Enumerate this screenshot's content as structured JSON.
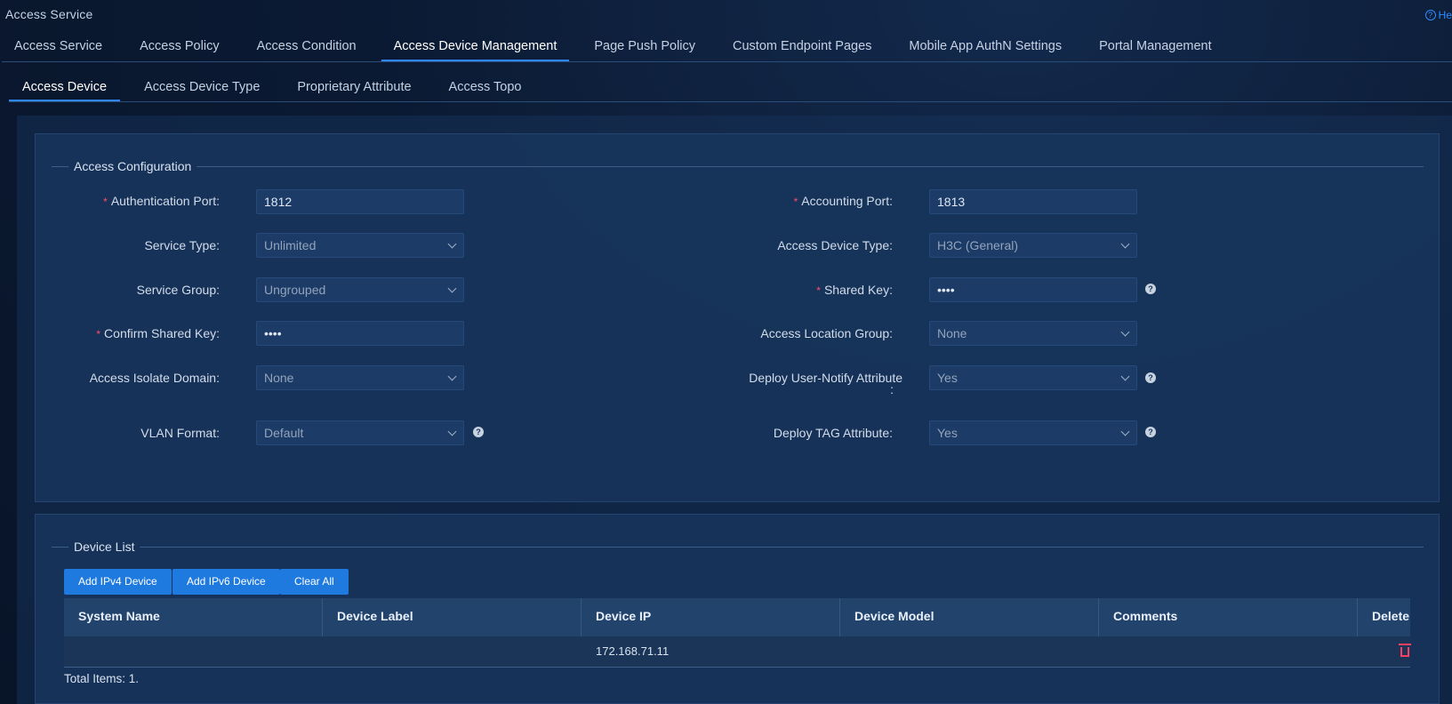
{
  "app": {
    "title": "Access Service",
    "help_label": "He"
  },
  "main_tabs": [
    {
      "label": "Access Service"
    },
    {
      "label": "Access Policy"
    },
    {
      "label": "Access Condition"
    },
    {
      "label": "Access Device Management",
      "active": true
    },
    {
      "label": "Page Push Policy"
    },
    {
      "label": "Custom Endpoint Pages"
    },
    {
      "label": "Mobile App AuthN Settings"
    },
    {
      "label": "Portal Management"
    }
  ],
  "sub_tabs": [
    {
      "label": "Access Device",
      "active": true
    },
    {
      "label": "Access Device Type"
    },
    {
      "label": "Proprietary Attribute"
    },
    {
      "label": "Access Topo"
    }
  ],
  "config": {
    "section_title": "Access Configuration",
    "required_mark": "*",
    "auth_port": {
      "label": "Authentication Port:",
      "value": "1812"
    },
    "acct_port": {
      "label": "Accounting Port:",
      "value": "1813"
    },
    "service_type": {
      "label": "Service Type:",
      "value": "Unlimited"
    },
    "access_device_type": {
      "label": "Access Device Type:",
      "value": "H3C (General)"
    },
    "service_group": {
      "label": "Service Group:",
      "value": "Ungrouped"
    },
    "shared_key": {
      "label": "Shared Key:",
      "value": "••••"
    },
    "confirm_shared_key": {
      "label": "Confirm Shared Key:",
      "value": "••••"
    },
    "access_location_group": {
      "label": "Access Location Group:",
      "value": "None"
    },
    "access_isolate_domain": {
      "label": "Access Isolate Domain:",
      "value": "None"
    },
    "deploy_user_notify": {
      "label": "Deploy User-Notify Attribute",
      "colon": ":",
      "value": "Yes"
    },
    "vlan_format": {
      "label": "VLAN Format:",
      "value": "Default"
    },
    "deploy_tag": {
      "label": "Deploy TAG Attribute:",
      "value": "Yes"
    }
  },
  "device_list": {
    "section_title": "Device List",
    "buttons": {
      "add_ipv4": "Add IPv4 Device",
      "add_ipv6": "Add IPv6 Device",
      "clear_all": "Clear All"
    },
    "columns": [
      "System Name",
      "Device Label",
      "Device IP",
      "Device Model",
      "Comments",
      "Delete"
    ],
    "rows": [
      {
        "system_name": "",
        "device_label": "",
        "device_ip": "172.168.71.11",
        "device_model": "",
        "comments": ""
      }
    ],
    "total": "Total Items: 1."
  },
  "colors": {
    "accent": "#1f7ae0",
    "required": "#ff4d6a",
    "delete": "#ff3d5f",
    "background": "#0b1a33"
  }
}
